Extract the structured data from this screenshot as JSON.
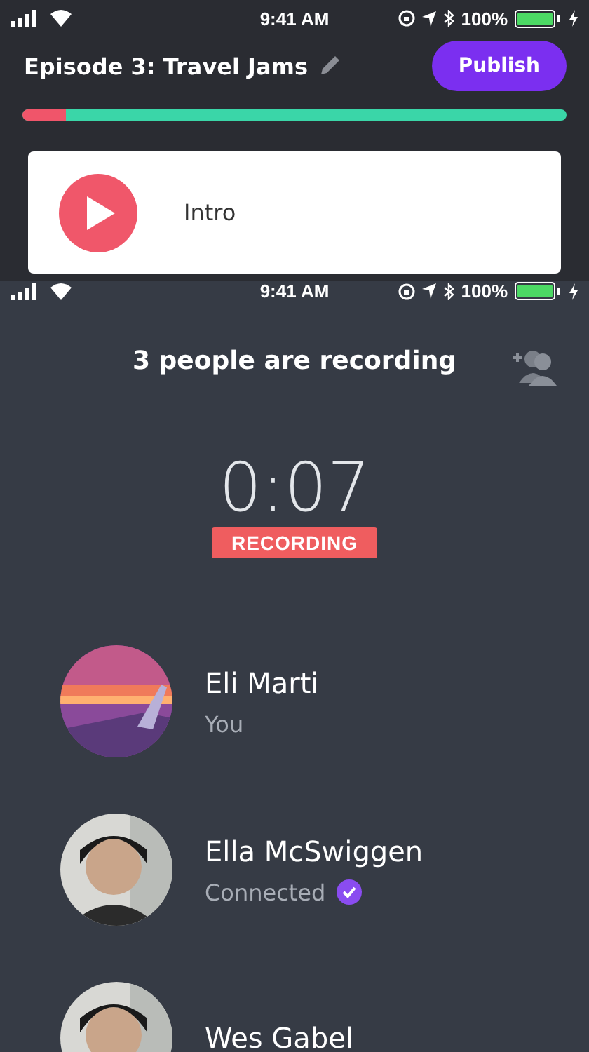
{
  "screens": [
    {
      "status_bar": {
        "time": "9:41 AM",
        "battery": "100%"
      },
      "episode": {
        "title": "Episode 3: Travel Jams",
        "publish_label": "Publish",
        "level": 0.08
      },
      "segments": [
        {
          "label": "Intro"
        }
      ]
    },
    {
      "status_bar": {
        "time": "9:41 AM",
        "battery": "100%"
      },
      "heading": "3 people are recording",
      "timer": "0:07",
      "badge": "RECORDING",
      "participants": [
        {
          "name": "Eli Marti",
          "status": "You",
          "verified": false,
          "kind": "scenery"
        },
        {
          "name": "Ella McSwiggen",
          "status": "Connected",
          "verified": true,
          "kind": "person"
        },
        {
          "name": "Wes Gabel",
          "kind": "person"
        }
      ]
    }
  ]
}
